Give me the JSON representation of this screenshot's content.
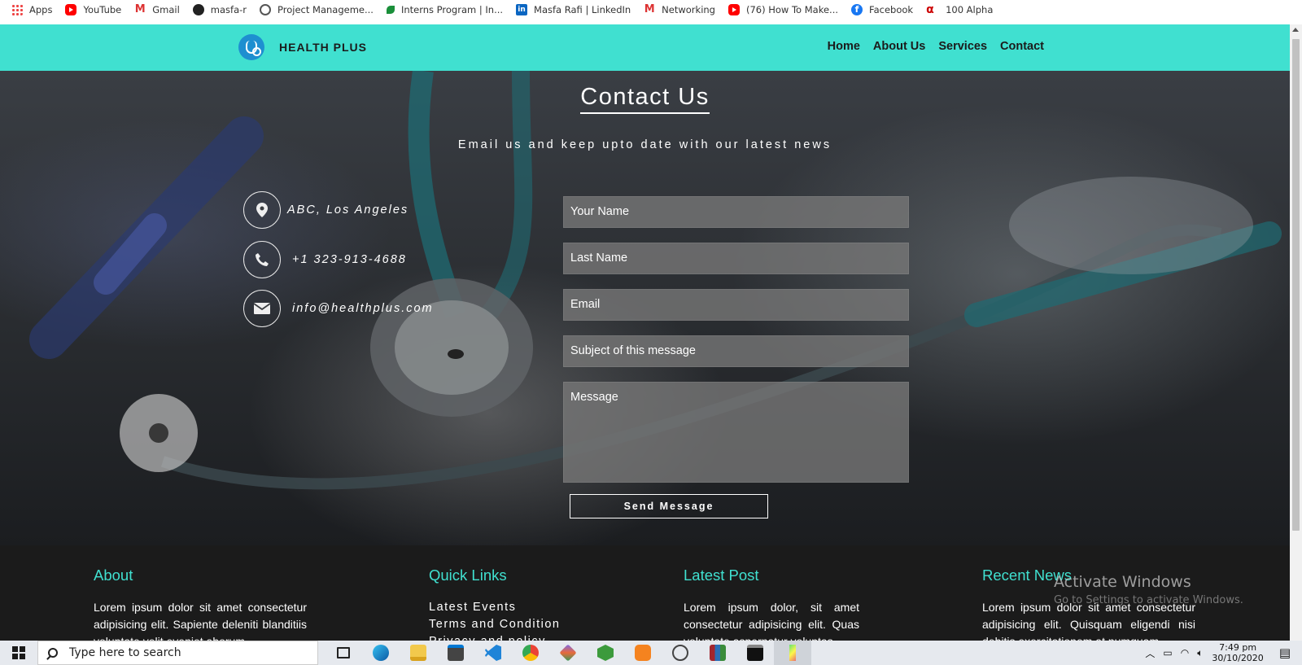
{
  "bookmarks": [
    {
      "label": "Apps",
      "icon": "apps-grid-icon"
    },
    {
      "label": "YouTube",
      "icon": "youtube-icon"
    },
    {
      "label": "Gmail",
      "icon": "gmail-icon"
    },
    {
      "label": "masfa-r",
      "icon": "github-icon"
    },
    {
      "label": "Project Manageme...",
      "icon": "globe-icon"
    },
    {
      "label": "Interns Program | In...",
      "icon": "interns-icon"
    },
    {
      "label": "Masfa Rafi | LinkedIn",
      "icon": "linkedin-icon"
    },
    {
      "label": "Networking",
      "icon": "gmail-icon"
    },
    {
      "label": "(76) How To Make...",
      "icon": "youtube-icon"
    },
    {
      "label": "Facebook",
      "icon": "facebook-icon"
    },
    {
      "label": "100 Alpha",
      "icon": "alpha-icon"
    }
  ],
  "navbar": {
    "brand": "HEALTH PLUS",
    "links": [
      "Home",
      "About Us",
      "Services",
      "Contact"
    ],
    "bg_color": "#40e0d0"
  },
  "contact": {
    "title": "Contact Us",
    "subtitle": "Email us and keep upto date with our latest news",
    "address": "ABC, Los Angeles",
    "phone": "+1 323-913-4688",
    "email": "info@healthplus.com",
    "form": {
      "first_name_placeholder": "Your Name",
      "last_name_placeholder": "Last Name",
      "email_placeholder": "Email",
      "subject_placeholder": "Subject of this message",
      "message_placeholder": "Message",
      "submit_label": "Send Message"
    }
  },
  "footer": {
    "accent_color": "#40e0d0",
    "about": {
      "heading": "About",
      "text": "Lorem ipsum dolor sit amet consectetur adipisicing elit. Sapiente deleniti blanditiis voluptate velit eveniet aborum"
    },
    "quick_links": {
      "heading": "Quick Links",
      "items": [
        "Latest Events",
        "Terms and Condition",
        "Privacy and policy"
      ]
    },
    "latest_post": {
      "heading": "Latest Post",
      "text": "Lorem ipsum dolor, sit amet consectetur adipisicing elit. Quas voluptate aspernatur voluptas"
    },
    "recent_news": {
      "heading": "Recent News",
      "text": "Lorem ipsum dolor sit amet consectetur adipisicing elit. Quisquam eligendi nisi debitis exercitationem at numquam"
    }
  },
  "watermark": {
    "line1": "Activate Windows",
    "line2": "Go to Settings to activate Windows."
  },
  "taskbar": {
    "search_placeholder": "Type here to search",
    "time": "7:49 pm",
    "date": "30/10/2020"
  }
}
